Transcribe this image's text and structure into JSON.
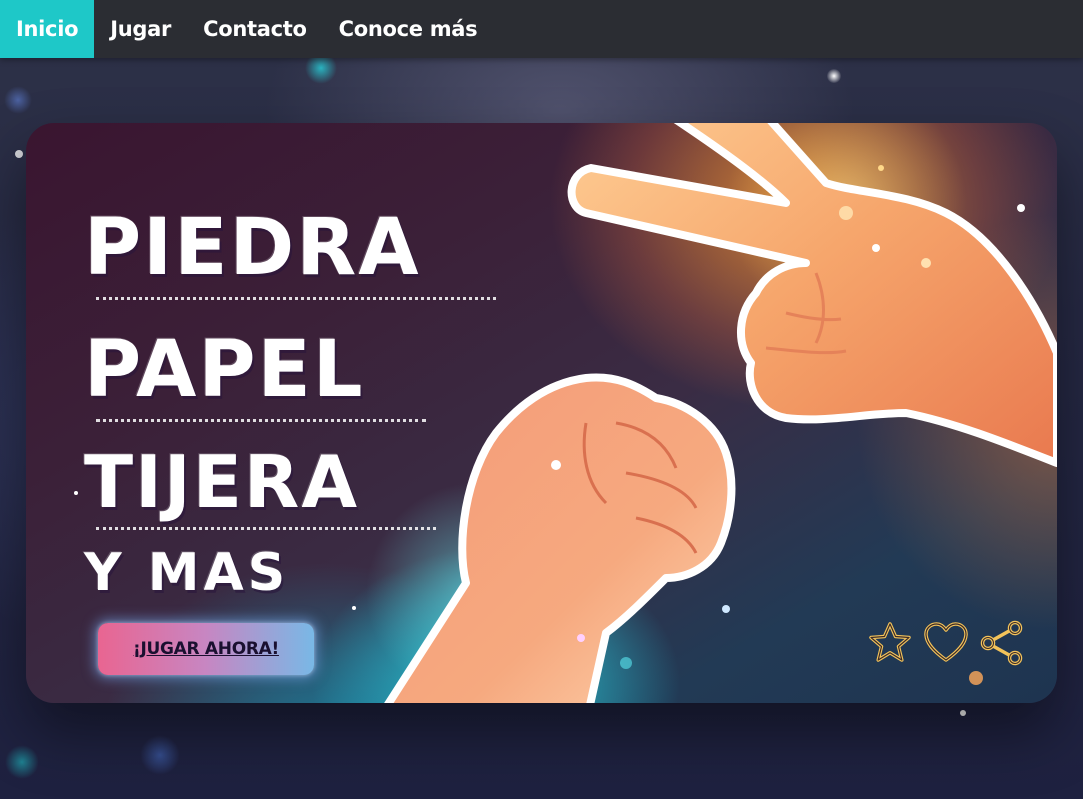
{
  "nav": {
    "items": [
      {
        "label": "Inicio",
        "active": true
      },
      {
        "label": "Jugar",
        "active": false
      },
      {
        "label": "Contacto",
        "active": false
      },
      {
        "label": "Conoce más",
        "active": false
      }
    ]
  },
  "hero": {
    "title_lines": [
      "PIEDRA",
      "PAPEL",
      "TIJERA",
      "Y MAS"
    ],
    "cta_label": "¡JUGAR AHORA!",
    "actions": [
      {
        "icon": "star-icon"
      },
      {
        "icon": "heart-icon"
      },
      {
        "icon": "share-icon"
      }
    ]
  },
  "colors": {
    "nav_bg": "#2b2d33",
    "nav_active": "#1ec8c8",
    "cta_gradient_start": "#e96591",
    "cta_gradient_end": "#79b8e6",
    "icon_outline": "#f3c35a"
  }
}
